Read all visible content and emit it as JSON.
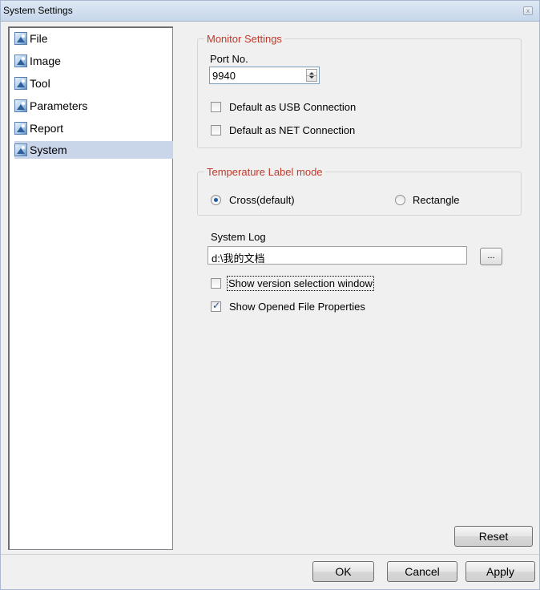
{
  "window": {
    "title": "System Settings",
    "close_glyph": "x"
  },
  "sidebar": {
    "items": [
      {
        "label": "File",
        "icon": "picture-icon",
        "selected": false
      },
      {
        "label": "Image",
        "icon": "picture-icon",
        "selected": false
      },
      {
        "label": "Tool",
        "icon": "picture-icon",
        "selected": false
      },
      {
        "label": "Parameters",
        "icon": "picture-icon",
        "selected": false
      },
      {
        "label": "Report",
        "icon": "picture-icon",
        "selected": false
      },
      {
        "label": "System",
        "icon": "picture-icon",
        "selected": true
      }
    ]
  },
  "monitor": {
    "title": "Monitor Settings",
    "port_label": "Port No.",
    "port_value": "9940",
    "usb_label": "Default as USB Connection",
    "usb_checked": false,
    "net_label": "Default as NET Connection",
    "net_checked": false
  },
  "temperature": {
    "title": "Temperature Label mode",
    "cross_label": "Cross(default)",
    "cross_selected": true,
    "rect_label": "Rectangle",
    "rect_selected": false
  },
  "system_log": {
    "label": "System Log",
    "path": "d:\\我的文档",
    "browse_label": "..."
  },
  "options": {
    "version_label": "Show version selection window",
    "version_checked": false,
    "opened_label": "Show Opened File Properties",
    "opened_checked": true
  },
  "buttons": {
    "reset": "Reset",
    "ok": "OK",
    "cancel": "Cancel",
    "apply": "Apply"
  },
  "colors": {
    "group_title": "#c0392b",
    "selection": "#c9d6ea"
  }
}
